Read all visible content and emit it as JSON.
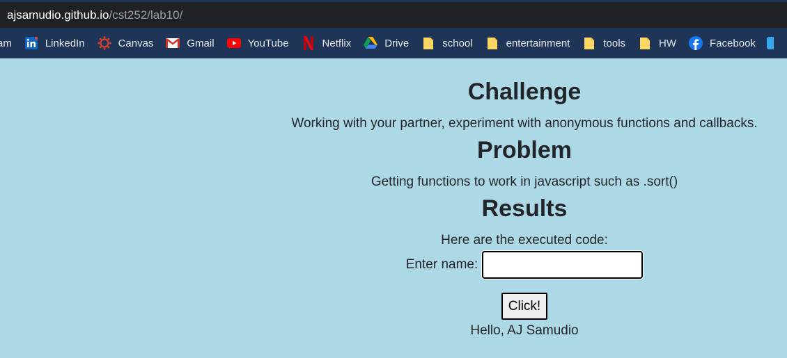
{
  "browser": {
    "url_host": "ajsamudio.github.io",
    "url_path": "/cst252/lab10/"
  },
  "bookmarks": [
    {
      "label": "am",
      "icon": "instagram-icon-cut"
    },
    {
      "label": "LinkedIn",
      "icon": "linkedin-icon"
    },
    {
      "label": "Canvas",
      "icon": "canvas-icon"
    },
    {
      "label": "Gmail",
      "icon": "gmail-icon"
    },
    {
      "label": "YouTube",
      "icon": "youtube-icon"
    },
    {
      "label": "Netflix",
      "icon": "netflix-icon"
    },
    {
      "label": "Drive",
      "icon": "google-drive-icon"
    },
    {
      "label": "school",
      "icon": "folder-icon"
    },
    {
      "label": "entertainment",
      "icon": "folder-icon"
    },
    {
      "label": "tools",
      "icon": "folder-icon"
    },
    {
      "label": "HW",
      "icon": "folder-icon"
    },
    {
      "label": "Facebook",
      "icon": "facebook-icon"
    }
  ],
  "page": {
    "challenge_heading": "Challenge",
    "challenge_text": "Working with your partner, experiment with anonymous functions and callbacks.",
    "problem_heading": "Problem",
    "problem_text": "Getting functions to work in javascript such as .sort()",
    "results_heading": "Results",
    "results_text": "Here are the executed code:",
    "name_label": "Enter name:",
    "name_value": "",
    "button_label": "Click!",
    "greeting": "Hello, AJ Samudio"
  },
  "colors": {
    "page_background": "#add8e6",
    "bookmarks_bar": "#1e3557",
    "address_bar": "#202124"
  }
}
